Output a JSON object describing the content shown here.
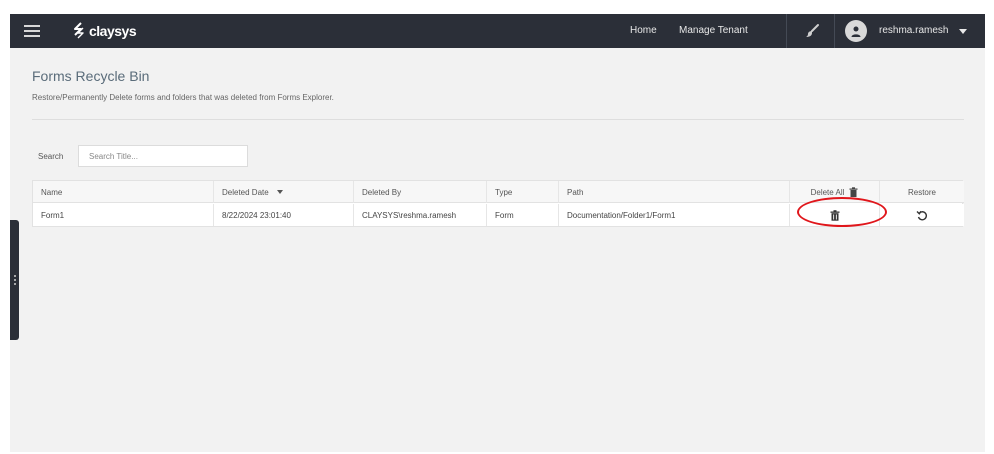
{
  "header": {
    "logo_text": "claysys",
    "nav": [
      "Home",
      "Manage Tenant"
    ],
    "username": "reshma.ramesh",
    "icons": [
      "menu-icon",
      "brush-icon",
      "user-avatar-icon",
      "chevron-down-icon"
    ]
  },
  "page": {
    "title": "Forms Recycle Bin",
    "subtitle": "Restore/Permanently Delete forms and folders that was deleted from Forms Explorer."
  },
  "search": {
    "label": "Search",
    "placeholder": "Search Title..."
  },
  "table": {
    "columns": [
      "Name",
      "Deleted Date",
      "Deleted By",
      "Type",
      "Path",
      "Delete All",
      "Restore"
    ],
    "rows": [
      {
        "name": "Form1",
        "deleted_date": "8/22/2024 23:01:40",
        "deleted_by": "CLAYSYS\\reshma.ramesh",
        "type": "Form",
        "path": "Documentation/Folder1/Form1"
      }
    ]
  },
  "colors": {
    "topbar": "#2b2f38",
    "background": "#f2f2f2",
    "annotation": "#e0161b",
    "title": "#5a6c7a"
  }
}
